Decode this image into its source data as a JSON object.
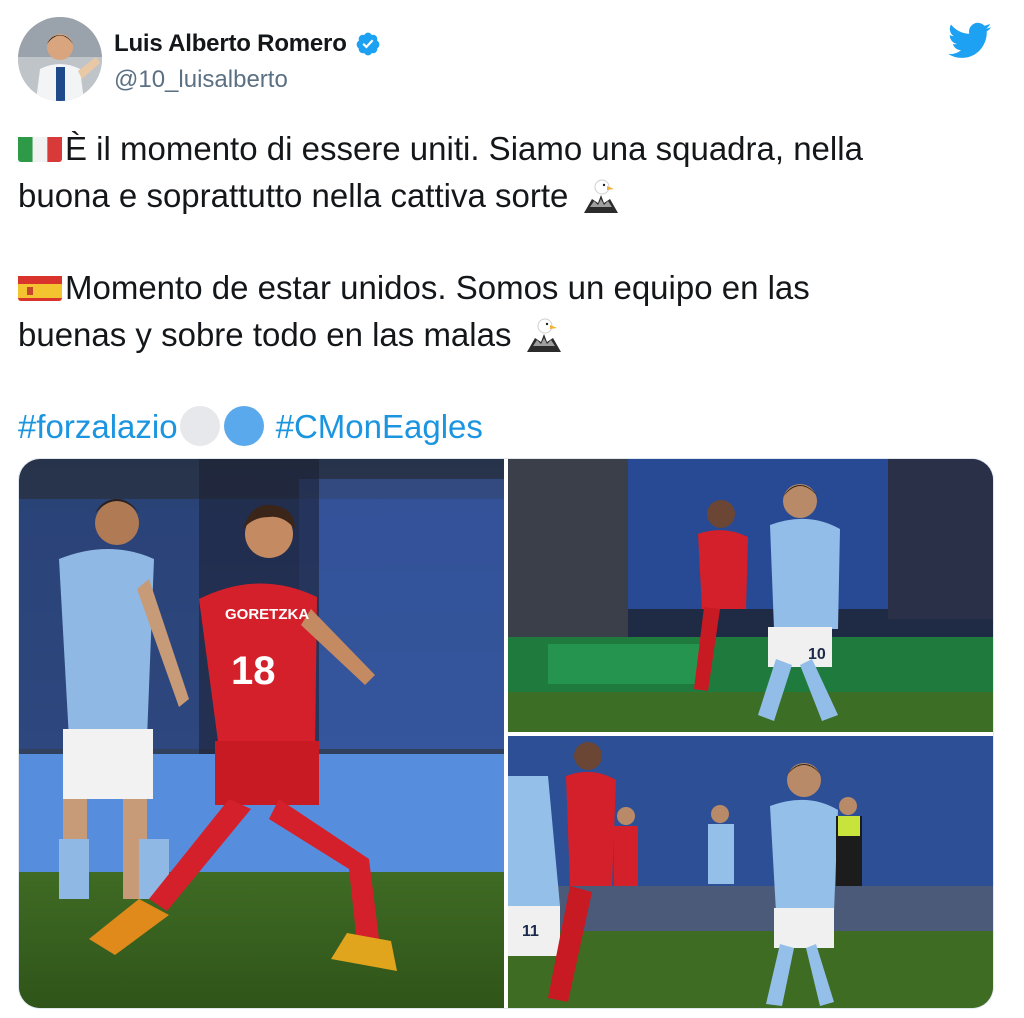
{
  "user": {
    "name": "Luis Alberto Romero",
    "handle": "@10_luisalberto",
    "verified": true,
    "avatar_icon": "avatar"
  },
  "brand": {
    "logo_icon": "twitter-bird-icon",
    "color": "#1da1f2"
  },
  "tweet": {
    "para_it_line1": "È il momento di essere uniti. Siamo una squadra, nella",
    "para_it_line2": "buona e soprattutto nella cattiva sorte",
    "para_es_line1": "Momento de estar unidos. Somos un equipo en las",
    "para_es_line2": "buenas y sobre todo en las malas",
    "hashtags": [
      "#forzalazio",
      "#CMonEagles"
    ],
    "hashtag_color": "#1b95e0"
  },
  "media": {
    "photos": [
      {
        "jersey_number": "18",
        "jersey_name": "GORETZKA"
      },
      {
        "jersey_number": "10"
      },
      {
        "jersey_number": "11"
      }
    ]
  }
}
